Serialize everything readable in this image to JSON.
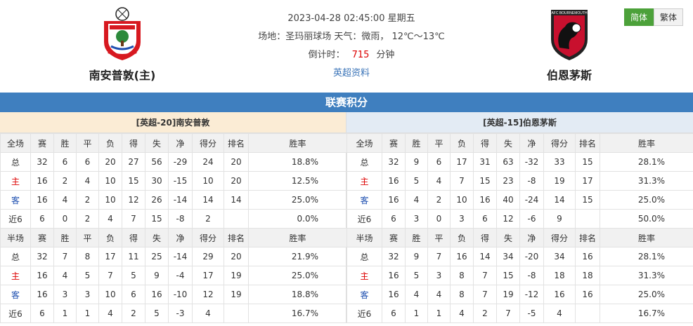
{
  "header": {
    "datetime": "2023-04-28 02:45:00 星期五",
    "venue_line": "场地：圣玛丽球场 天气：微雨， 12℃～13℃",
    "countdown_label": "倒计时：",
    "countdown_value": "715",
    "countdown_unit": "分钟",
    "league_link": "英超资料",
    "home_team": "南安普敦(主)",
    "away_team": "伯恩茅斯",
    "lang_simplified": "简体",
    "lang_traditional": "繁体"
  },
  "section_title": "联赛积分",
  "colors": {
    "accent": "#3f7fbf",
    "home_head": "#fbecd5",
    "away_head": "#e3ebf4",
    "lang_active": "#4ca13a"
  },
  "home": {
    "title": "[英超-20]南安普敦",
    "full": {
      "headers": [
        "全场",
        "赛",
        "胜",
        "平",
        "负",
        "得",
        "失",
        "净",
        "得分",
        "排名",
        "胜率"
      ],
      "rows": [
        [
          "总",
          "32",
          "6",
          "6",
          "20",
          "27",
          "56",
          "-29",
          "24",
          "20",
          "18.8%"
        ],
        [
          "主",
          "16",
          "2",
          "4",
          "10",
          "15",
          "30",
          "-15",
          "10",
          "20",
          "12.5%"
        ],
        [
          "客",
          "16",
          "4",
          "2",
          "10",
          "12",
          "26",
          "-14",
          "14",
          "14",
          "25.0%"
        ],
        [
          "近6",
          "6",
          "0",
          "2",
          "4",
          "7",
          "15",
          "-8",
          "2",
          "",
          "0.0%"
        ]
      ]
    },
    "half": {
      "headers": [
        "半场",
        "赛",
        "胜",
        "平",
        "负",
        "得",
        "失",
        "净",
        "得分",
        "排名",
        "胜率"
      ],
      "rows": [
        [
          "总",
          "32",
          "7",
          "8",
          "17",
          "11",
          "25",
          "-14",
          "29",
          "20",
          "21.9%"
        ],
        [
          "主",
          "16",
          "4",
          "5",
          "7",
          "5",
          "9",
          "-4",
          "17",
          "19",
          "25.0%"
        ],
        [
          "客",
          "16",
          "3",
          "3",
          "10",
          "6",
          "16",
          "-10",
          "12",
          "19",
          "18.8%"
        ],
        [
          "近6",
          "6",
          "1",
          "1",
          "4",
          "2",
          "5",
          "-3",
          "4",
          "",
          "16.7%"
        ]
      ]
    }
  },
  "away": {
    "title": "[英超-15]伯恩茅斯",
    "full": {
      "headers": [
        "全场",
        "赛",
        "胜",
        "平",
        "负",
        "得",
        "失",
        "净",
        "得分",
        "排名",
        "胜率"
      ],
      "rows": [
        [
          "总",
          "32",
          "9",
          "6",
          "17",
          "31",
          "63",
          "-32",
          "33",
          "15",
          "28.1%"
        ],
        [
          "主",
          "16",
          "5",
          "4",
          "7",
          "15",
          "23",
          "-8",
          "19",
          "17",
          "31.3%"
        ],
        [
          "客",
          "16",
          "4",
          "2",
          "10",
          "16",
          "40",
          "-24",
          "14",
          "15",
          "25.0%"
        ],
        [
          "近6",
          "6",
          "3",
          "0",
          "3",
          "6",
          "12",
          "-6",
          "9",
          "",
          "50.0%"
        ]
      ]
    },
    "half": {
      "headers": [
        "半场",
        "赛",
        "胜",
        "平",
        "负",
        "得",
        "失",
        "净",
        "得分",
        "排名",
        "胜率"
      ],
      "rows": [
        [
          "总",
          "32",
          "9",
          "7",
          "16",
          "14",
          "34",
          "-20",
          "34",
          "16",
          "28.1%"
        ],
        [
          "主",
          "16",
          "5",
          "3",
          "8",
          "7",
          "15",
          "-8",
          "18",
          "18",
          "31.3%"
        ],
        [
          "客",
          "16",
          "4",
          "4",
          "8",
          "7",
          "19",
          "-12",
          "16",
          "16",
          "25.0%"
        ],
        [
          "近6",
          "6",
          "1",
          "1",
          "4",
          "2",
          "7",
          "-5",
          "4",
          "",
          "16.7%"
        ]
      ]
    }
  }
}
